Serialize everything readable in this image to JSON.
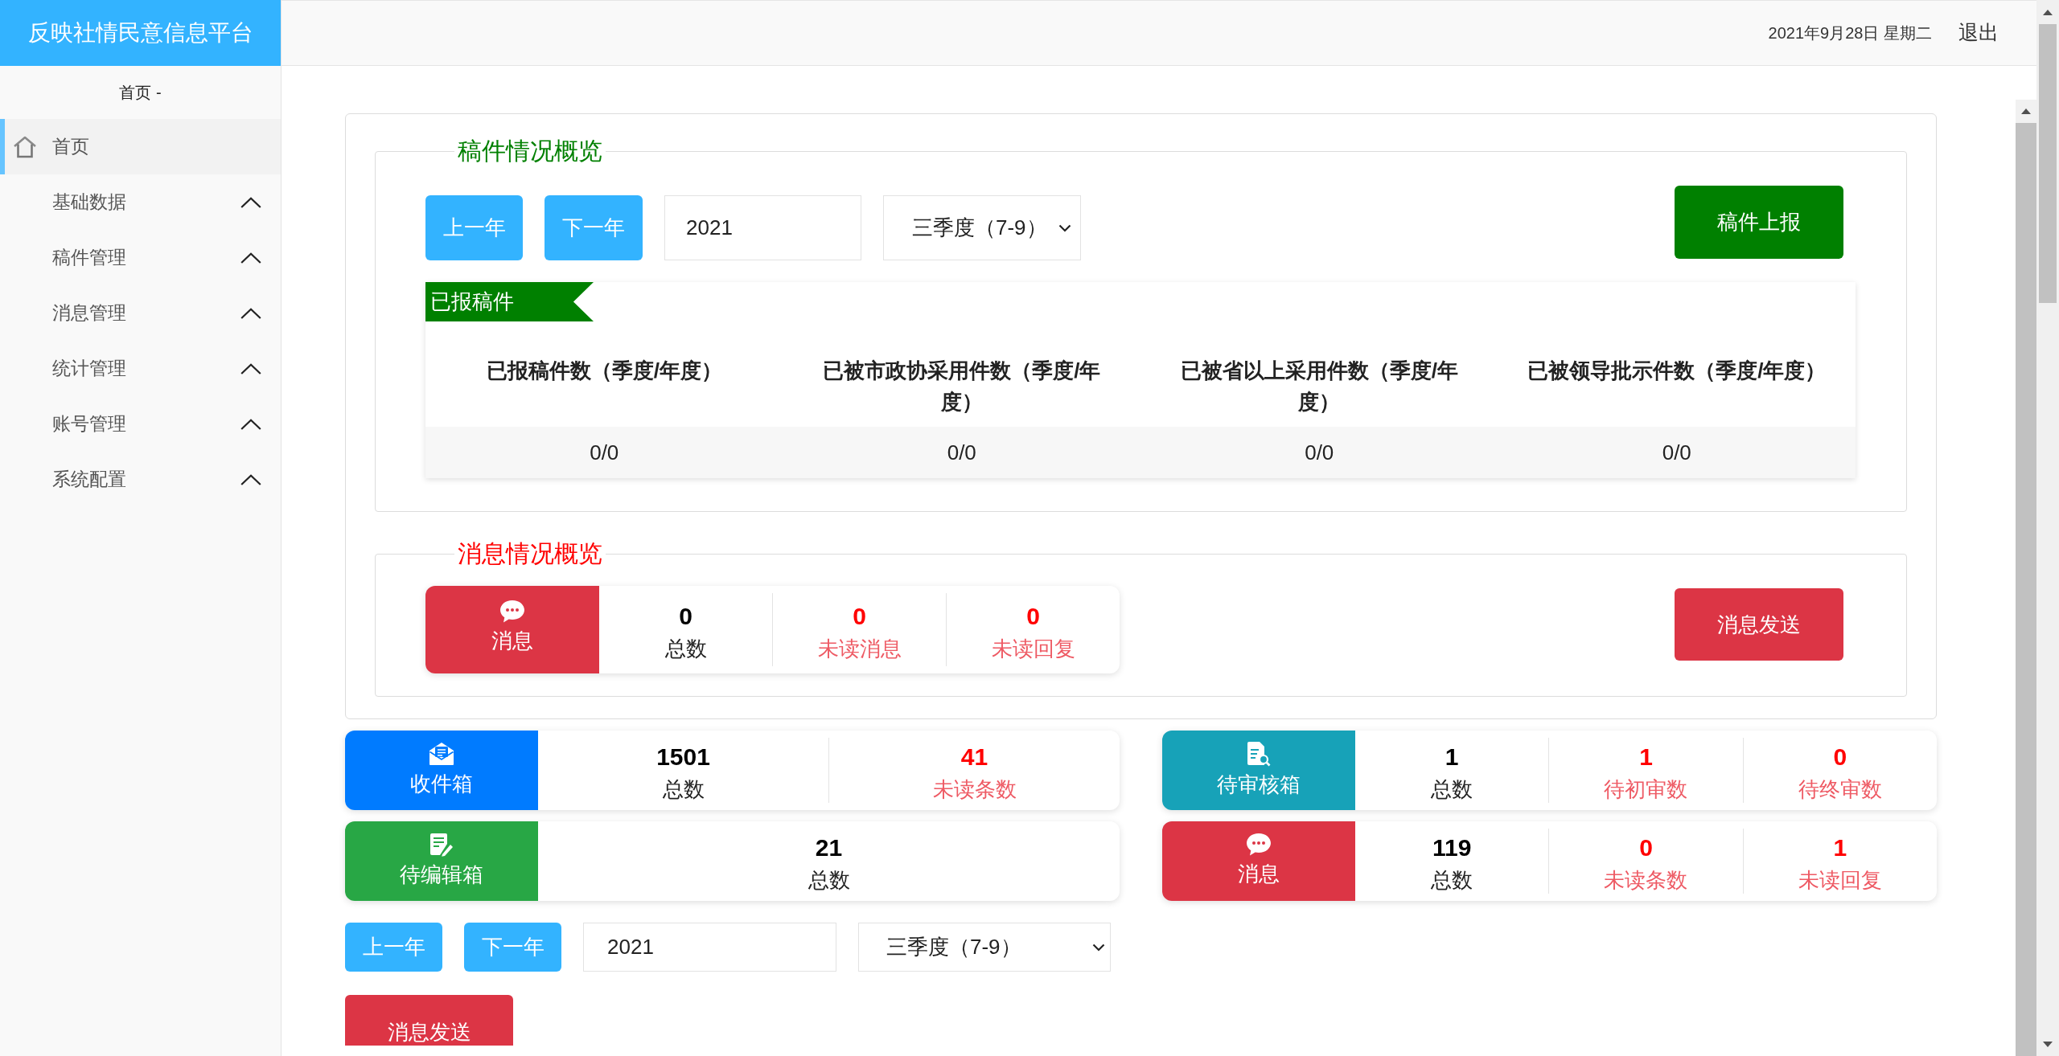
{
  "sidebar": {
    "title": "反映社情民意信息平台",
    "breadcrumb": "首页 -",
    "items": [
      {
        "label": "首页",
        "kind": "home",
        "selected": true
      },
      {
        "label": "基础数据",
        "kind": "group",
        "selected": false
      },
      {
        "label": "稿件管理",
        "kind": "group",
        "selected": false
      },
      {
        "label": "消息管理",
        "kind": "group",
        "selected": false
      },
      {
        "label": "统计管理",
        "kind": "group",
        "selected": false
      },
      {
        "label": "账号管理",
        "kind": "group",
        "selected": false
      },
      {
        "label": "系统配置",
        "kind": "group",
        "selected": false
      }
    ]
  },
  "header": {
    "date": "2021年9月28日 星期二",
    "logout": "退出"
  },
  "manuscripts": {
    "legend": "稿件情况概览",
    "prev_year": "上一年",
    "next_year": "下一年",
    "year": "2021",
    "quarter": "三季度（7-9）",
    "report_button": "稿件上报",
    "ribbon": "已报稿件",
    "table": {
      "columns": [
        "已报稿件数（季度/年度）",
        "已被市政协采用件数（季度/年度）",
        "已被省以上采用件数（季度/年度）",
        "已被领导批示件数（季度/年度）"
      ],
      "rows": [
        [
          "0/0",
          "0/0",
          "0/0",
          "0/0"
        ]
      ]
    }
  },
  "messages": {
    "legend": "消息情况概览",
    "card": {
      "kind": "message",
      "label": "消息",
      "color": "#dc3545",
      "stats": [
        {
          "value": "0",
          "label": "总数",
          "kind": "total"
        },
        {
          "value": "0",
          "label": "未读消息",
          "kind": "unread"
        },
        {
          "value": "0",
          "label": "未读回复",
          "kind": "unread"
        }
      ]
    },
    "send_button": "消息发送"
  },
  "stat_cards": [
    {
      "kind": "inbox",
      "label": "收件箱",
      "color": "#007bff",
      "stats": [
        {
          "value": "1501",
          "label": "总数",
          "kind": "total"
        },
        {
          "value": "41",
          "label": "未读条数",
          "kind": "unread"
        }
      ]
    },
    {
      "kind": "review",
      "label": "待审核箱",
      "color": "#17a2b8",
      "stats": [
        {
          "value": "1",
          "label": "总数",
          "kind": "total"
        },
        {
          "value": "1",
          "label": "待初审数",
          "kind": "unread"
        },
        {
          "value": "0",
          "label": "待终审数",
          "kind": "unread"
        }
      ]
    },
    {
      "kind": "edit",
      "label": "待编辑箱",
      "color": "#28a745",
      "stats": [
        {
          "value": "21",
          "label": "总数",
          "kind": "total"
        }
      ]
    },
    {
      "kind": "message",
      "label": "消息",
      "color": "#dc3545",
      "stats": [
        {
          "value": "119",
          "label": "总数",
          "kind": "total"
        },
        {
          "value": "0",
          "label": "未读条数",
          "kind": "unread"
        },
        {
          "value": "1",
          "label": "未读回复",
          "kind": "unread"
        }
      ]
    }
  ],
  "filter": {
    "prev_year": "上一年",
    "next_year": "下一年",
    "year": "2021",
    "quarter": "三季度（7-9）"
  },
  "send_button": "消息发送"
}
